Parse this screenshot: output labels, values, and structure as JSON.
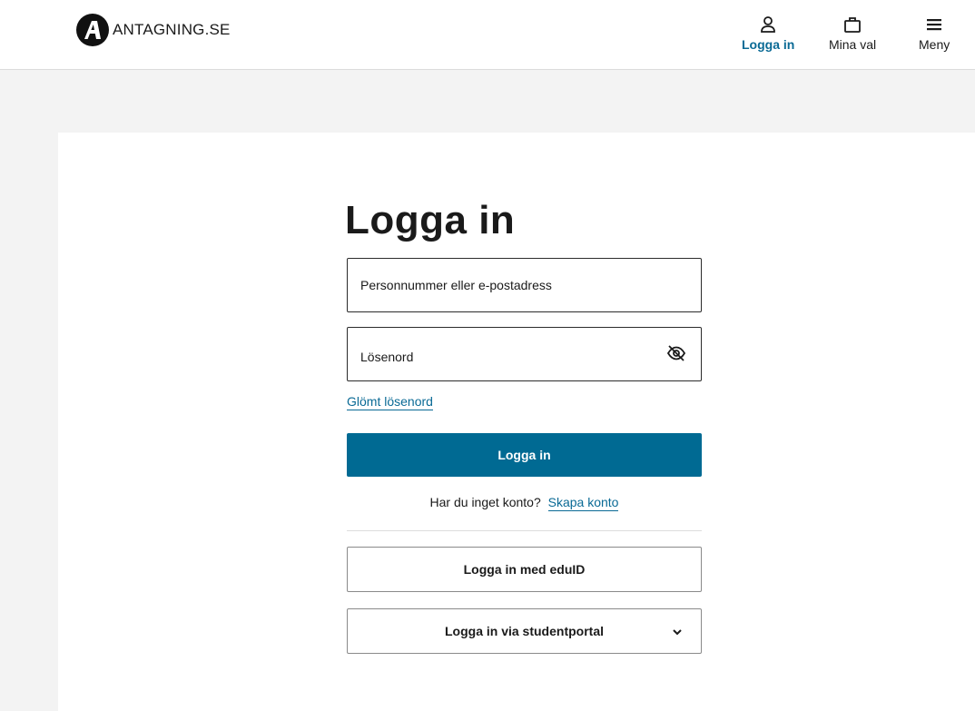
{
  "header": {
    "brand": "ANTAGNING.SE",
    "nav": {
      "login_label": "Logga in",
      "choices_label": "Mina val",
      "menu_label": "Meny"
    }
  },
  "login": {
    "title": "Logga in",
    "username_placeholder": "Personnummer eller e-postadress",
    "password_placeholder": "Lösenord",
    "forgot_password": "Glömt lösenord",
    "submit_label": "Logga in",
    "no_account_text": "Har du inget konto?",
    "create_account": "Skapa konto",
    "eduid_label": "Logga in med eduID",
    "studentportal_label": "Logga in via studentportal"
  },
  "colors": {
    "accent": "#006a93",
    "link": "#0a6a95",
    "page_background": "#f3f3f3"
  },
  "icons": {
    "logo": "antagning-a-logo",
    "login": "user-icon",
    "choices": "briefcase-icon",
    "menu": "hamburger-icon",
    "password_toggle": "eye-slash-icon",
    "dropdown": "chevron-down-icon"
  }
}
